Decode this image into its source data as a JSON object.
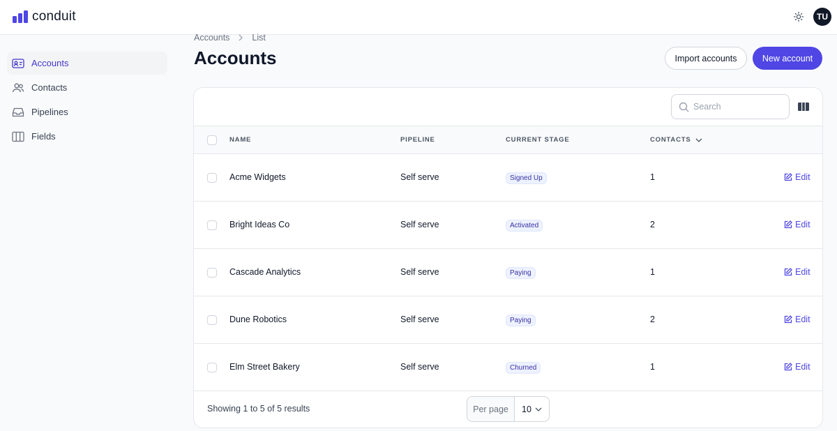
{
  "app": {
    "name": "conduit"
  },
  "header": {
    "avatar_initials": "TU"
  },
  "sidebar": {
    "items": [
      {
        "label": "Accounts",
        "icon": "id-card-icon",
        "active": true
      },
      {
        "label": "Contacts",
        "icon": "users-icon",
        "active": false
      },
      {
        "label": "Pipelines",
        "icon": "inbox-icon",
        "active": false
      },
      {
        "label": "Fields",
        "icon": "columns-icon",
        "active": false
      }
    ]
  },
  "breadcrumb": {
    "parent": "Accounts",
    "current": "List"
  },
  "page": {
    "title": "Accounts",
    "import_label": "Import accounts",
    "new_label": "New account"
  },
  "search": {
    "placeholder": "Search"
  },
  "table": {
    "columns": {
      "name": "NAME",
      "pipeline": "PIPELINE",
      "stage": "CURRENT STAGE",
      "contacts": "CONTACTS"
    },
    "edit_label": "Edit",
    "rows": [
      {
        "name": "Acme Widgets",
        "pipeline": "Self serve",
        "stage": "Signed Up",
        "contacts": "1"
      },
      {
        "name": "Bright Ideas Co",
        "pipeline": "Self serve",
        "stage": "Activated",
        "contacts": "2"
      },
      {
        "name": "Cascade Analytics",
        "pipeline": "Self serve",
        "stage": "Paying",
        "contacts": "1"
      },
      {
        "name": "Dune Robotics",
        "pipeline": "Self serve",
        "stage": "Paying",
        "contacts": "2"
      },
      {
        "name": "Elm Street Bakery",
        "pipeline": "Self serve",
        "stage": "Churned",
        "contacts": "1"
      }
    ]
  },
  "pagination": {
    "showing": "Showing 1 to 5 of 5 results",
    "per_page_label": "Per page",
    "per_page_value": "10"
  },
  "colors": {
    "accent": "#4f46e5",
    "active_nav_text": "#4338ca",
    "badge_bg": "#eef2ff"
  }
}
